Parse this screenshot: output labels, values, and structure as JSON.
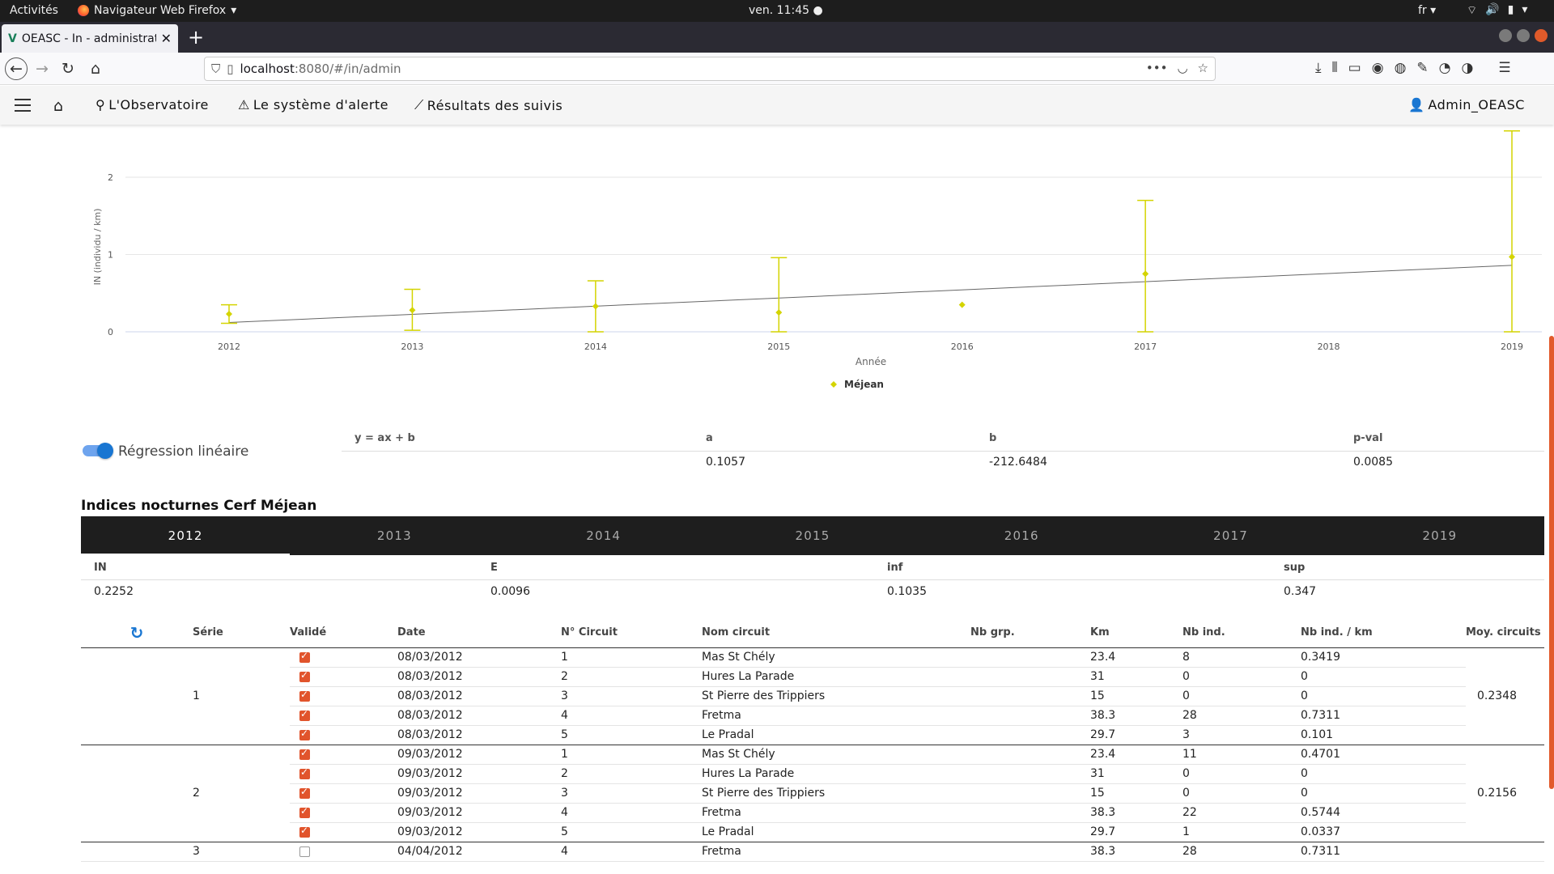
{
  "system": {
    "activities": "Activités",
    "app_name": "Navigateur Web Firefox",
    "clock": "ven. 11:45",
    "lang": "fr"
  },
  "browser": {
    "tab_title": "OEASC - In - administrati",
    "url_host": "localhost",
    "url_path": ":8080/#/in/admin"
  },
  "app": {
    "nav": {
      "observatoire": "L'Observatoire",
      "alerte": "Le système d'alerte",
      "resultats": "Résultats des suivis",
      "user": "Admin_OEASC"
    }
  },
  "chart_data": {
    "type": "scatter",
    "title": "",
    "xlabel": "Année",
    "ylabel": "IN (individu / km)",
    "x_ticks": [
      "2012",
      "2013",
      "2014",
      "2015",
      "2016",
      "2017",
      "2018",
      "2019"
    ],
    "ylim": [
      0,
      2.6
    ],
    "y_ticks": [
      "0",
      "1",
      "2"
    ],
    "legend": "bottom-center",
    "series": [
      {
        "name": "Méjean",
        "color": "#d4d400",
        "points": [
          {
            "x": 2012,
            "y": 0.23,
            "low": 0.11,
            "high": 0.35
          },
          {
            "x": 2013,
            "y": 0.28,
            "low": 0.02,
            "high": 0.55
          },
          {
            "x": 2014,
            "y": 0.33,
            "low": 0.0,
            "high": 0.66
          },
          {
            "x": 2015,
            "y": 0.25,
            "low": 0.0,
            "high": 0.96
          },
          {
            "x": 2016,
            "y": 0.35,
            "low": null,
            "high": null
          },
          {
            "x": 2017,
            "y": 0.75,
            "low": 0.0,
            "high": 1.7
          },
          {
            "x": 2019,
            "y": 0.97,
            "low": 0.0,
            "high": 2.6
          }
        ]
      }
    ],
    "regression_line": {
      "x": [
        2012,
        2019
      ],
      "y": [
        0.12,
        0.86
      ]
    }
  },
  "regression": {
    "toggle_label": "Régression linéaire",
    "headers": [
      "y = ax + b",
      "a",
      "b",
      "p-val"
    ],
    "values": [
      "",
      "0.1057",
      "-212.6484",
      "0.0085"
    ]
  },
  "section_title": "Indices nocturnes Cerf Méjean",
  "years": [
    "2012",
    "2013",
    "2014",
    "2015",
    "2016",
    "2017",
    "2019"
  ],
  "stats": {
    "headers": [
      "IN",
      "E",
      "inf",
      "sup"
    ],
    "values": [
      "0.2252",
      "0.0096",
      "0.1035",
      "0.347"
    ]
  },
  "table": {
    "headers": [
      "Série",
      "Validé",
      "Date",
      "N° Circuit",
      "Nom circuit",
      "Nb grp.",
      "Km",
      "Nb ind.",
      "Nb ind. / km",
      "Moy. circuits"
    ],
    "groups": [
      {
        "serie": "1",
        "moy": "0.2348",
        "rows": [
          {
            "valide": true,
            "date": "08/03/2012",
            "circuit": "1",
            "nom": "Mas St Chély",
            "nbgrp": "",
            "km": "23.4",
            "nbind": "8",
            "ratio": "0.3419"
          },
          {
            "valide": true,
            "date": "08/03/2012",
            "circuit": "2",
            "nom": "Hures La Parade",
            "nbgrp": "",
            "km": "31",
            "nbind": "0",
            "ratio": "0"
          },
          {
            "valide": true,
            "date": "08/03/2012",
            "circuit": "3",
            "nom": "St Pierre des Trippiers",
            "nbgrp": "",
            "km": "15",
            "nbind": "0",
            "ratio": "0"
          },
          {
            "valide": true,
            "date": "08/03/2012",
            "circuit": "4",
            "nom": "Fretma",
            "nbgrp": "",
            "km": "38.3",
            "nbind": "28",
            "ratio": "0.7311"
          },
          {
            "valide": true,
            "date": "08/03/2012",
            "circuit": "5",
            "nom": "Le Pradal",
            "nbgrp": "",
            "km": "29.7",
            "nbind": "3",
            "ratio": "0.101"
          }
        ]
      },
      {
        "serie": "2",
        "moy": "0.2156",
        "rows": [
          {
            "valide": true,
            "date": "09/03/2012",
            "circuit": "1",
            "nom": "Mas St Chély",
            "nbgrp": "",
            "km": "23.4",
            "nbind": "11",
            "ratio": "0.4701"
          },
          {
            "valide": true,
            "date": "09/03/2012",
            "circuit": "2",
            "nom": "Hures La Parade",
            "nbgrp": "",
            "km": "31",
            "nbind": "0",
            "ratio": "0"
          },
          {
            "valide": true,
            "date": "09/03/2012",
            "circuit": "3",
            "nom": "St Pierre des Trippiers",
            "nbgrp": "",
            "km": "15",
            "nbind": "0",
            "ratio": "0"
          },
          {
            "valide": true,
            "date": "09/03/2012",
            "circuit": "4",
            "nom": "Fretma",
            "nbgrp": "",
            "km": "38.3",
            "nbind": "22",
            "ratio": "0.5744"
          },
          {
            "valide": true,
            "date": "09/03/2012",
            "circuit": "5",
            "nom": "Le Pradal",
            "nbgrp": "",
            "km": "29.7",
            "nbind": "1",
            "ratio": "0.0337"
          }
        ]
      },
      {
        "serie": "3",
        "moy": "",
        "rows": [
          {
            "valide": false,
            "date": "04/04/2012",
            "circuit": "4",
            "nom": "Fretma",
            "nbgrp": "",
            "km": "38.3",
            "nbind": "28",
            "ratio": "0.7311"
          }
        ]
      }
    ]
  }
}
